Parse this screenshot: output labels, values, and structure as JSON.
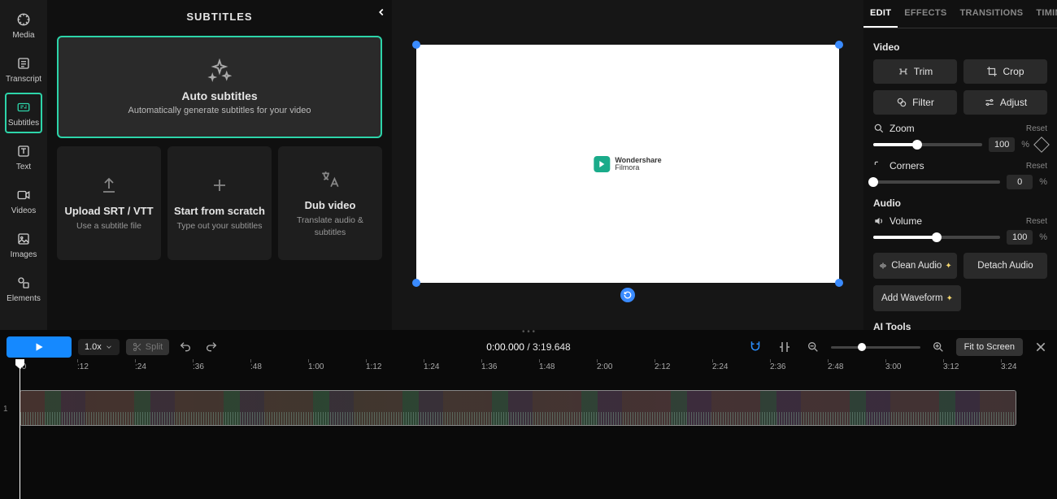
{
  "nav": [
    {
      "label": "Media",
      "icon": "media"
    },
    {
      "label": "Transcript",
      "icon": "transcript"
    },
    {
      "label": "Subtitles",
      "icon": "subtitles"
    },
    {
      "label": "Text",
      "icon": "text"
    },
    {
      "label": "Videos",
      "icon": "videos"
    },
    {
      "label": "Images",
      "icon": "images"
    },
    {
      "label": "Elements",
      "icon": "elements"
    }
  ],
  "panel": {
    "title": "SUBTITLES",
    "auto": {
      "title": "Auto subtitles",
      "sub": "Automatically generate subtitles for your video"
    },
    "cards": [
      {
        "title": "Upload SRT / VTT",
        "sub": "Use a subtitle file"
      },
      {
        "title": "Start from scratch",
        "sub": "Type out your subtitles"
      },
      {
        "title": "Dub video",
        "sub": "Translate audio & subtitles"
      }
    ]
  },
  "watermark": {
    "line1": "Wondershare",
    "line2": "Filmora"
  },
  "right": {
    "tabs": [
      "EDIT",
      "EFFECTS",
      "TRANSITIONS",
      "TIMING"
    ],
    "video_label": "Video",
    "trim": "Trim",
    "crop": "Crop",
    "filter": "Filter",
    "adjust": "Adjust",
    "zoom_label": "Zoom",
    "zoom_val": "100",
    "zoom_unit": "%",
    "reset": "Reset",
    "corners_label": "Corners",
    "corners_val": "0",
    "corners_unit": "%",
    "audio_label": "Audio",
    "volume_label": "Volume",
    "volume_val": "100",
    "volume_unit": "%",
    "clean": "Clean Audio",
    "detach": "Detach Audio",
    "waveform": "Add Waveform",
    "ai_label": "AI Tools"
  },
  "toolbar": {
    "speed": "1.0x",
    "split": "Split",
    "time_cur": "0:00.000",
    "time_sep": " / ",
    "time_total": "3:19.648",
    "fit": "Fit to Screen"
  },
  "ticks": [
    ":0",
    ":12",
    ":24",
    ":36",
    ":48",
    "1:00",
    "1:12",
    "1:24",
    "1:36",
    "1:48",
    "2:00",
    "2:12",
    "2:24",
    "2:36",
    "2:48",
    "3:00",
    "3:12",
    "3:24"
  ],
  "track_num": "1"
}
